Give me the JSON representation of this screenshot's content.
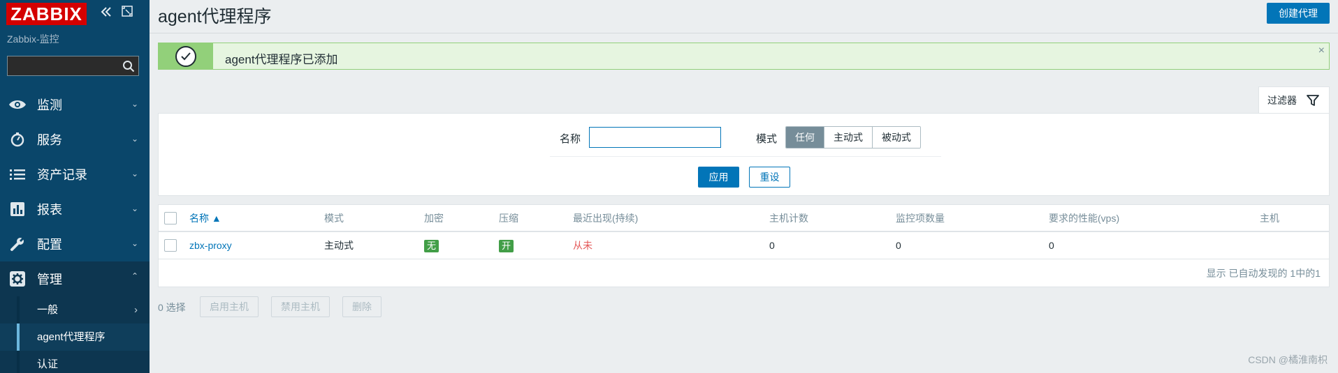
{
  "sidebar": {
    "logo": "ZABBIX",
    "server_name": "Zabbix-监控",
    "search_placeholder": "",
    "menu": [
      {
        "label": "监测",
        "icon": "eye-icon"
      },
      {
        "label": "服务",
        "icon": "stopwatch-icon"
      },
      {
        "label": "资产记录",
        "icon": "list-icon"
      },
      {
        "label": "报表",
        "icon": "bar-chart-icon"
      },
      {
        "label": "配置",
        "icon": "wrench-icon"
      },
      {
        "label": "管理",
        "icon": "gear-icon"
      }
    ],
    "submenu": [
      {
        "label": "一般"
      },
      {
        "label": "agent代理程序"
      },
      {
        "label": "认证"
      }
    ]
  },
  "header": {
    "title": "agent代理程序",
    "create_button": "创建代理"
  },
  "message": {
    "text": "agent代理程序已添加",
    "close": "×"
  },
  "filter": {
    "tab_label": "过滤器",
    "name_label": "名称",
    "name_value": "",
    "mode_label": "模式",
    "mode_options": [
      "任何",
      "主动式",
      "被动式"
    ],
    "mode_selected": "任何",
    "apply_label": "应用",
    "reset_label": "重设"
  },
  "table": {
    "columns": [
      "名称 ▲",
      "模式",
      "加密",
      "压缩",
      "最近出现(持续)",
      "主机计数",
      "监控项数量",
      "要求的性能(vps)",
      "主机"
    ],
    "rows": [
      {
        "name": "zbx-proxy",
        "mode": "主动式",
        "encryption": "无",
        "compression": "开",
        "last_seen": "从未",
        "host_count": "0",
        "item_count": "0",
        "required_performance": "0",
        "hosts": ""
      }
    ],
    "footer": "显示 已自动发现的 1中的1"
  },
  "actions": {
    "selected_count": "0 选择",
    "enable_hosts": "启用主机",
    "disable_hosts": "禁用主机",
    "delete": "删除"
  },
  "watermark": "CSDN @橘淮南枳",
  "colors": {
    "sidebar_bg": "#0a466a",
    "brand_red": "#d40000",
    "accent_blue": "#0275b8",
    "success_green": "#429e47",
    "message_green": "#92d07a",
    "error_red": "#e45959"
  }
}
